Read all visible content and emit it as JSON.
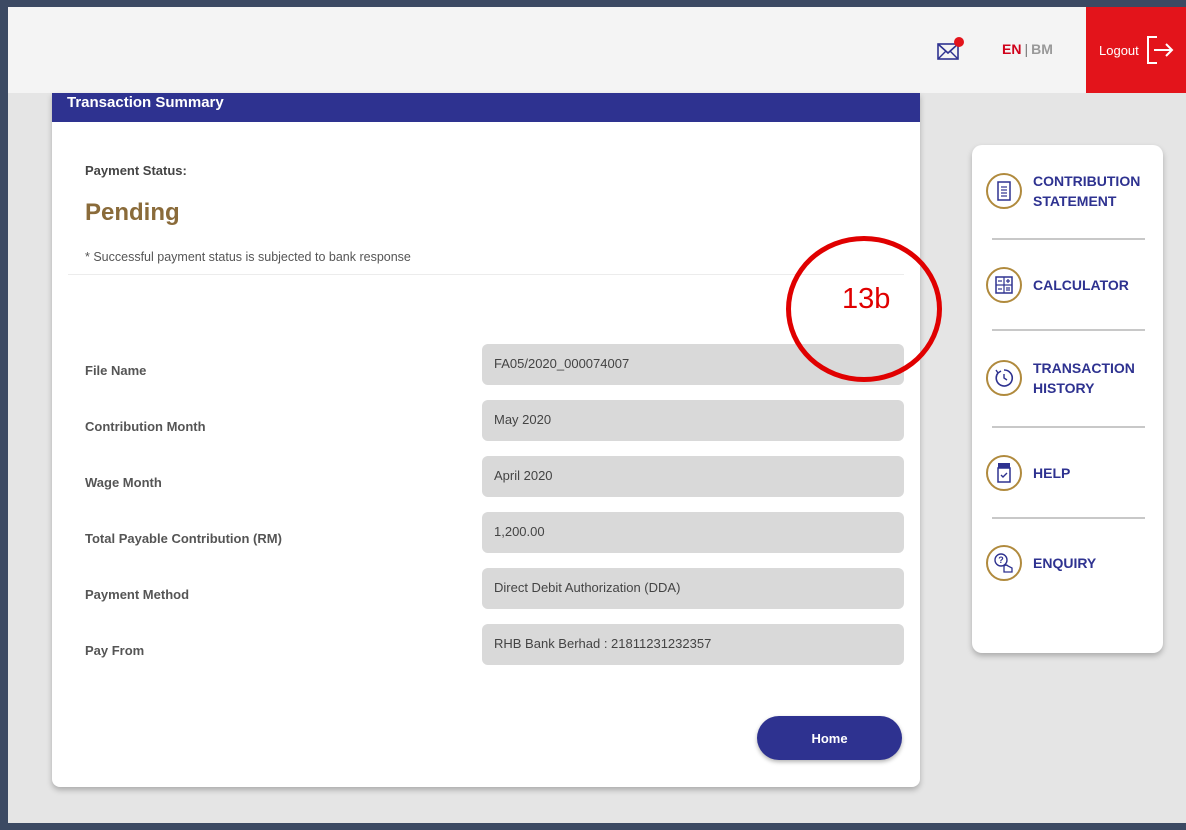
{
  "header": {
    "lang_en": "EN",
    "lang_sep": "|",
    "lang_bm": "BM",
    "logout_label": "Logout"
  },
  "summary": {
    "title": "Transaction Summary",
    "status_label": "Payment Status:",
    "status_value": "Pending",
    "note": "* Successful payment status is subjected to bank response",
    "rows": [
      {
        "label": "File Name",
        "value": "FA05/2020_000074007"
      },
      {
        "label": "Contribution Month",
        "value": "May 2020"
      },
      {
        "label": "Wage Month",
        "value": "April 2020"
      },
      {
        "label": "Total Payable Contribution (RM)",
        "value": "1,200.00"
      },
      {
        "label": "Payment Method",
        "value": "Direct Debit Authorization (DDA)"
      },
      {
        "label": "Pay From",
        "value": "RHB Bank Berhad : 21811231232357"
      }
    ],
    "home_label": "Home"
  },
  "annotation": {
    "label": "13b",
    "color": "#e00000"
  },
  "sidebar": {
    "items": [
      {
        "line1": "CONTRIBUTION",
        "line2": "STATEMENT",
        "icon": "document-icon"
      },
      {
        "line1": "CALCULATOR",
        "line2": "",
        "icon": "calculator-icon"
      },
      {
        "line1": "TRANSACTION",
        "line2": "HISTORY",
        "icon": "history-icon"
      },
      {
        "line1": "HELP",
        "line2": "",
        "icon": "help-icon"
      },
      {
        "line1": "ENQUIRY",
        "line2": "",
        "icon": "enquiry-icon"
      }
    ]
  },
  "colors": {
    "brand_navy": "#2e3290",
    "logout_red": "#e3141b",
    "pending_gold": "#8a6b3a",
    "icon_gold": "#b08a3d"
  }
}
